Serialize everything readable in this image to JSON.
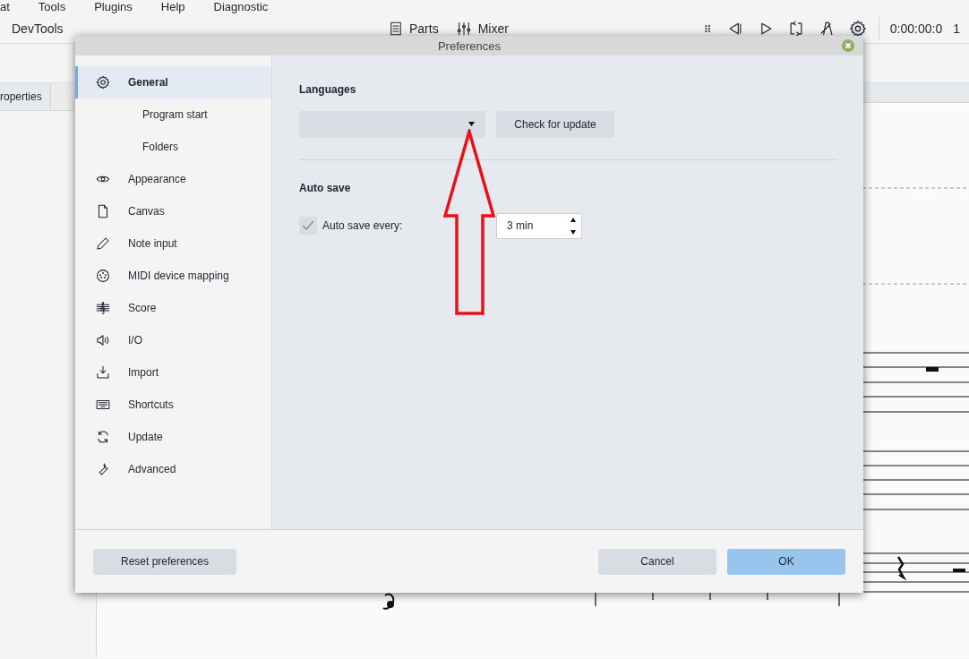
{
  "menu": [
    "at",
    "Tools",
    "Plugins",
    "Help",
    "Diagnostic"
  ],
  "toolbar": {
    "title": "DevTools",
    "buttons": [
      {
        "label": "Parts"
      },
      {
        "label": "Mixer"
      }
    ],
    "time": "0:00:00:0",
    "extra": "1"
  },
  "left_panel": {
    "tab": "roperties"
  },
  "dialog": {
    "title": "Preferences",
    "nav": [
      {
        "label": "General",
        "selected": true,
        "children": [
          {
            "label": "Program start",
            "selected": false
          },
          {
            "label": "Folders",
            "selected": false
          }
        ]
      },
      {
        "label": "Appearance",
        "selected": false
      },
      {
        "label": "Canvas",
        "selected": false
      },
      {
        "label": "Note input",
        "selected": false
      },
      {
        "label": "MIDI device mapping",
        "selected": false
      },
      {
        "label": "Score",
        "selected": false
      },
      {
        "label": "I/O",
        "selected": false
      },
      {
        "label": "Import",
        "selected": false
      },
      {
        "label": "Shortcuts",
        "selected": false
      },
      {
        "label": "Update",
        "selected": false
      },
      {
        "label": "Advanced",
        "selected": false
      }
    ],
    "languages": {
      "heading": "Languages",
      "button": "Check for update"
    },
    "auto_save": {
      "heading": "Auto save",
      "label": "Auto save every:",
      "checked": true,
      "value": "3 min"
    },
    "footer_buttons": [
      {
        "label": "Reset preferences",
        "kind": "secondary"
      },
      {
        "label": "Cancel",
        "kind": "secondary"
      },
      {
        "label": "OK",
        "kind": "primary"
      }
    ]
  }
}
